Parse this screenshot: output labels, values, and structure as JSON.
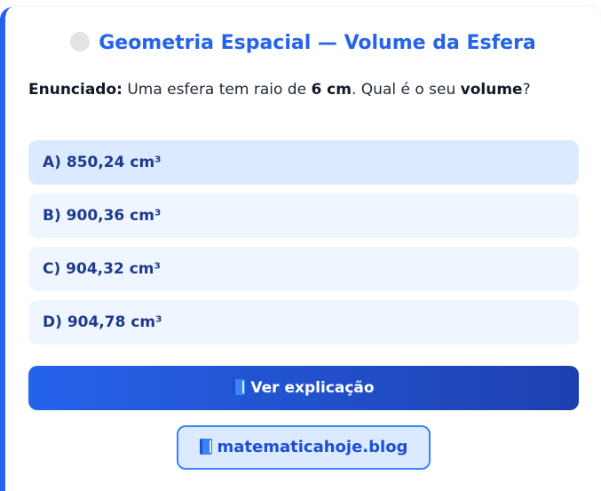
{
  "title": "Geometria Espacial — Volume da Esfera",
  "statement": {
    "label": "Enunciado:",
    "text_1": " Uma esfera tem raio de ",
    "radius": "6 cm",
    "text_2": ". Qual é o seu ",
    "keyword": "volume",
    "text_3": "?"
  },
  "options": [
    {
      "letter": "A)",
      "value": "850,24 cm³"
    },
    {
      "letter": "B)",
      "value": "900,36 cm³"
    },
    {
      "letter": "C)",
      "value": "904,32 cm³"
    },
    {
      "letter": "D)",
      "value": "904,78 cm³"
    }
  ],
  "explain_button": {
    "label": "Ver explicação",
    "icon": "book-icon"
  },
  "blog_link": {
    "label": "matematicahoje.blog",
    "icon": "book-icon"
  },
  "colors": {
    "accent": "#2563eb",
    "option_bg": "#eff6ff",
    "option_selected_bg": "#dbeafe",
    "option_text": "#1e3a8a"
  }
}
